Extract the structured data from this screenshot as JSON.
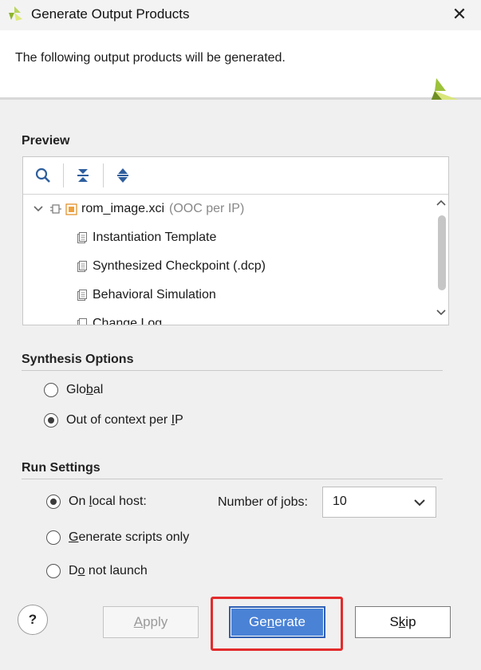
{
  "window": {
    "title": "Generate Output Products",
    "close_glyph": "✕"
  },
  "header": {
    "description": "The following output products will be generated."
  },
  "preview": {
    "title": "Preview",
    "toolbar": {
      "search_icon": "search-icon",
      "collapse_icon": "collapse-all-icon",
      "expand_icon": "expand-all-icon"
    },
    "tree": {
      "root": {
        "name": "rom_image.xci",
        "note": "(OOC per IP)"
      },
      "children": [
        "Instantiation Template",
        "Synthesized Checkpoint (.dcp)",
        "Behavioral Simulation"
      ],
      "partial_child": "Change Log"
    }
  },
  "synthesis": {
    "title": "Synthesis Options",
    "options": [
      {
        "pre": "Glo",
        "key": "b",
        "post": "al",
        "checked": false
      },
      {
        "pre": "Out of context per ",
        "key": "I",
        "post": "P",
        "checked": true
      }
    ]
  },
  "run": {
    "title": "Run Settings",
    "options": [
      {
        "pre": "On ",
        "key": "l",
        "post": "ocal host:",
        "checked": true
      },
      {
        "pre": "",
        "key": "G",
        "post": "enerate scripts only",
        "checked": false
      },
      {
        "pre": "D",
        "key": "o",
        "post": " not launch",
        "checked": false
      }
    ],
    "jobs_label": "Number of jobs:",
    "jobs_value": "10"
  },
  "buttons": {
    "help": "?",
    "apply": {
      "pre": "",
      "key": "A",
      "post": "pply"
    },
    "generate": {
      "pre": "Ge",
      "key": "n",
      "post": "erate"
    },
    "skip": {
      "pre": "S",
      "key": "k",
      "post": "ip"
    }
  },
  "colors": {
    "accent": "#4a82d6",
    "highlight": "#e32b2b",
    "brand_green": "#8db42e"
  }
}
